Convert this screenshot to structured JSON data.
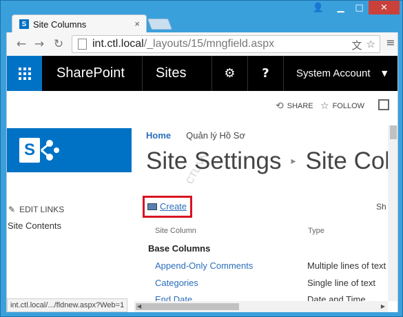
{
  "browser": {
    "tab_title": "Site Columns",
    "tab_close": "×",
    "url_host": "int.ctl.local",
    "url_path": "/_layouts/15/mngfield.aspx",
    "back_icon": "←",
    "forward_icon": "→",
    "reload_icon": "↻",
    "translate_icon": "文",
    "star_icon": "☆",
    "menu_icon": "≡",
    "window_user_icon": "👤",
    "window_min_icon": "▁",
    "window_max_icon": "□",
    "window_close_icon": "✕"
  },
  "suitebar": {
    "brand": "SharePoint",
    "sites": "Sites",
    "settings_icon": "⚙",
    "help_icon": "?",
    "user": "System Account",
    "caret": "▼",
    "accent": "#0072c6"
  },
  "ribbon": {
    "share_label": "SHARE",
    "share_icon": "⟲",
    "follow_label": "FOLLOW",
    "follow_icon": "☆"
  },
  "left": {
    "logo_letter": "S",
    "edit_links_icon": "✎",
    "edit_links": "EDIT LINKS",
    "nav_site_contents": "Site Contents"
  },
  "status_url": "int.ctl.local/.../fldnew.aspx?Web=1",
  "main": {
    "breadcrumb_home": "Home",
    "breadcrumb_site": "Quản lý Hồ Sơ",
    "title_part1": "Site Settings",
    "title_sep": "▸",
    "title_part2": "Site Colu",
    "watermark": "CTL.VN",
    "create_label": "Create",
    "show_label": "Sh",
    "header_site_column": "Site Column",
    "header_type": "Type",
    "group_name": "Base Columns",
    "rows": [
      {
        "name": "Append-Only Comments",
        "type": "Multiple lines of text"
      },
      {
        "name": "Categories",
        "type": "Single line of text"
      },
      {
        "name": "End Date",
        "type": "Date and Time"
      }
    ]
  },
  "scroll": {
    "up": "▲",
    "down": "▼",
    "left": "◀",
    "right": "▶"
  }
}
